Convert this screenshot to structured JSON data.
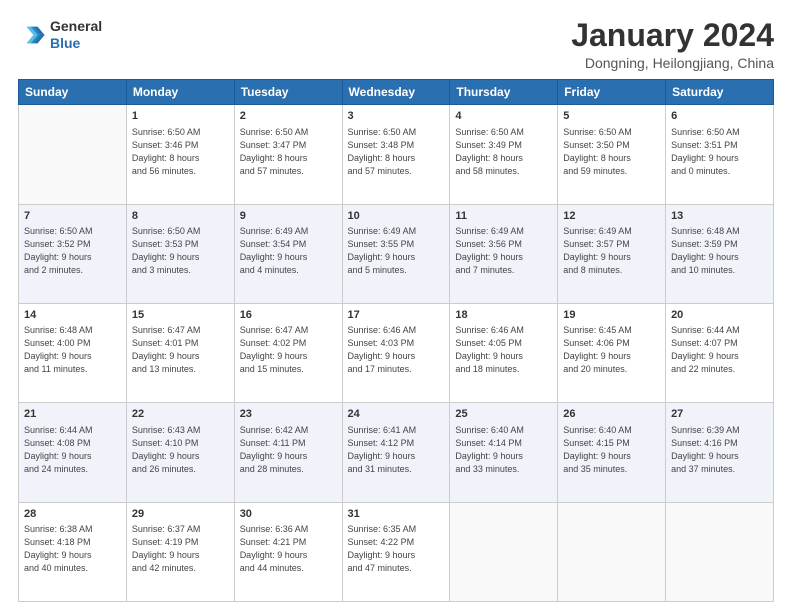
{
  "header": {
    "logo_line1": "General",
    "logo_line2": "Blue",
    "month": "January 2024",
    "location": "Dongning, Heilongjiang, China"
  },
  "weekdays": [
    "Sunday",
    "Monday",
    "Tuesday",
    "Wednesday",
    "Thursday",
    "Friday",
    "Saturday"
  ],
  "weeks": [
    [
      {
        "day": "",
        "info": ""
      },
      {
        "day": "1",
        "info": "Sunrise: 6:50 AM\nSunset: 3:46 PM\nDaylight: 8 hours\nand 56 minutes."
      },
      {
        "day": "2",
        "info": "Sunrise: 6:50 AM\nSunset: 3:47 PM\nDaylight: 8 hours\nand 57 minutes."
      },
      {
        "day": "3",
        "info": "Sunrise: 6:50 AM\nSunset: 3:48 PM\nDaylight: 8 hours\nand 57 minutes."
      },
      {
        "day": "4",
        "info": "Sunrise: 6:50 AM\nSunset: 3:49 PM\nDaylight: 8 hours\nand 58 minutes."
      },
      {
        "day": "5",
        "info": "Sunrise: 6:50 AM\nSunset: 3:50 PM\nDaylight: 8 hours\nand 59 minutes."
      },
      {
        "day": "6",
        "info": "Sunrise: 6:50 AM\nSunset: 3:51 PM\nDaylight: 9 hours\nand 0 minutes."
      }
    ],
    [
      {
        "day": "7",
        "info": "Sunrise: 6:50 AM\nSunset: 3:52 PM\nDaylight: 9 hours\nand 2 minutes."
      },
      {
        "day": "8",
        "info": "Sunrise: 6:50 AM\nSunset: 3:53 PM\nDaylight: 9 hours\nand 3 minutes."
      },
      {
        "day": "9",
        "info": "Sunrise: 6:49 AM\nSunset: 3:54 PM\nDaylight: 9 hours\nand 4 minutes."
      },
      {
        "day": "10",
        "info": "Sunrise: 6:49 AM\nSunset: 3:55 PM\nDaylight: 9 hours\nand 5 minutes."
      },
      {
        "day": "11",
        "info": "Sunrise: 6:49 AM\nSunset: 3:56 PM\nDaylight: 9 hours\nand 7 minutes."
      },
      {
        "day": "12",
        "info": "Sunrise: 6:49 AM\nSunset: 3:57 PM\nDaylight: 9 hours\nand 8 minutes."
      },
      {
        "day": "13",
        "info": "Sunrise: 6:48 AM\nSunset: 3:59 PM\nDaylight: 9 hours\nand 10 minutes."
      }
    ],
    [
      {
        "day": "14",
        "info": "Sunrise: 6:48 AM\nSunset: 4:00 PM\nDaylight: 9 hours\nand 11 minutes."
      },
      {
        "day": "15",
        "info": "Sunrise: 6:47 AM\nSunset: 4:01 PM\nDaylight: 9 hours\nand 13 minutes."
      },
      {
        "day": "16",
        "info": "Sunrise: 6:47 AM\nSunset: 4:02 PM\nDaylight: 9 hours\nand 15 minutes."
      },
      {
        "day": "17",
        "info": "Sunrise: 6:46 AM\nSunset: 4:03 PM\nDaylight: 9 hours\nand 17 minutes."
      },
      {
        "day": "18",
        "info": "Sunrise: 6:46 AM\nSunset: 4:05 PM\nDaylight: 9 hours\nand 18 minutes."
      },
      {
        "day": "19",
        "info": "Sunrise: 6:45 AM\nSunset: 4:06 PM\nDaylight: 9 hours\nand 20 minutes."
      },
      {
        "day": "20",
        "info": "Sunrise: 6:44 AM\nSunset: 4:07 PM\nDaylight: 9 hours\nand 22 minutes."
      }
    ],
    [
      {
        "day": "21",
        "info": "Sunrise: 6:44 AM\nSunset: 4:08 PM\nDaylight: 9 hours\nand 24 minutes."
      },
      {
        "day": "22",
        "info": "Sunrise: 6:43 AM\nSunset: 4:10 PM\nDaylight: 9 hours\nand 26 minutes."
      },
      {
        "day": "23",
        "info": "Sunrise: 6:42 AM\nSunset: 4:11 PM\nDaylight: 9 hours\nand 28 minutes."
      },
      {
        "day": "24",
        "info": "Sunrise: 6:41 AM\nSunset: 4:12 PM\nDaylight: 9 hours\nand 31 minutes."
      },
      {
        "day": "25",
        "info": "Sunrise: 6:40 AM\nSunset: 4:14 PM\nDaylight: 9 hours\nand 33 minutes."
      },
      {
        "day": "26",
        "info": "Sunrise: 6:40 AM\nSunset: 4:15 PM\nDaylight: 9 hours\nand 35 minutes."
      },
      {
        "day": "27",
        "info": "Sunrise: 6:39 AM\nSunset: 4:16 PM\nDaylight: 9 hours\nand 37 minutes."
      }
    ],
    [
      {
        "day": "28",
        "info": "Sunrise: 6:38 AM\nSunset: 4:18 PM\nDaylight: 9 hours\nand 40 minutes."
      },
      {
        "day": "29",
        "info": "Sunrise: 6:37 AM\nSunset: 4:19 PM\nDaylight: 9 hours\nand 42 minutes."
      },
      {
        "day": "30",
        "info": "Sunrise: 6:36 AM\nSunset: 4:21 PM\nDaylight: 9 hours\nand 44 minutes."
      },
      {
        "day": "31",
        "info": "Sunrise: 6:35 AM\nSunset: 4:22 PM\nDaylight: 9 hours\nand 47 minutes."
      },
      {
        "day": "",
        "info": ""
      },
      {
        "day": "",
        "info": ""
      },
      {
        "day": "",
        "info": ""
      }
    ]
  ]
}
